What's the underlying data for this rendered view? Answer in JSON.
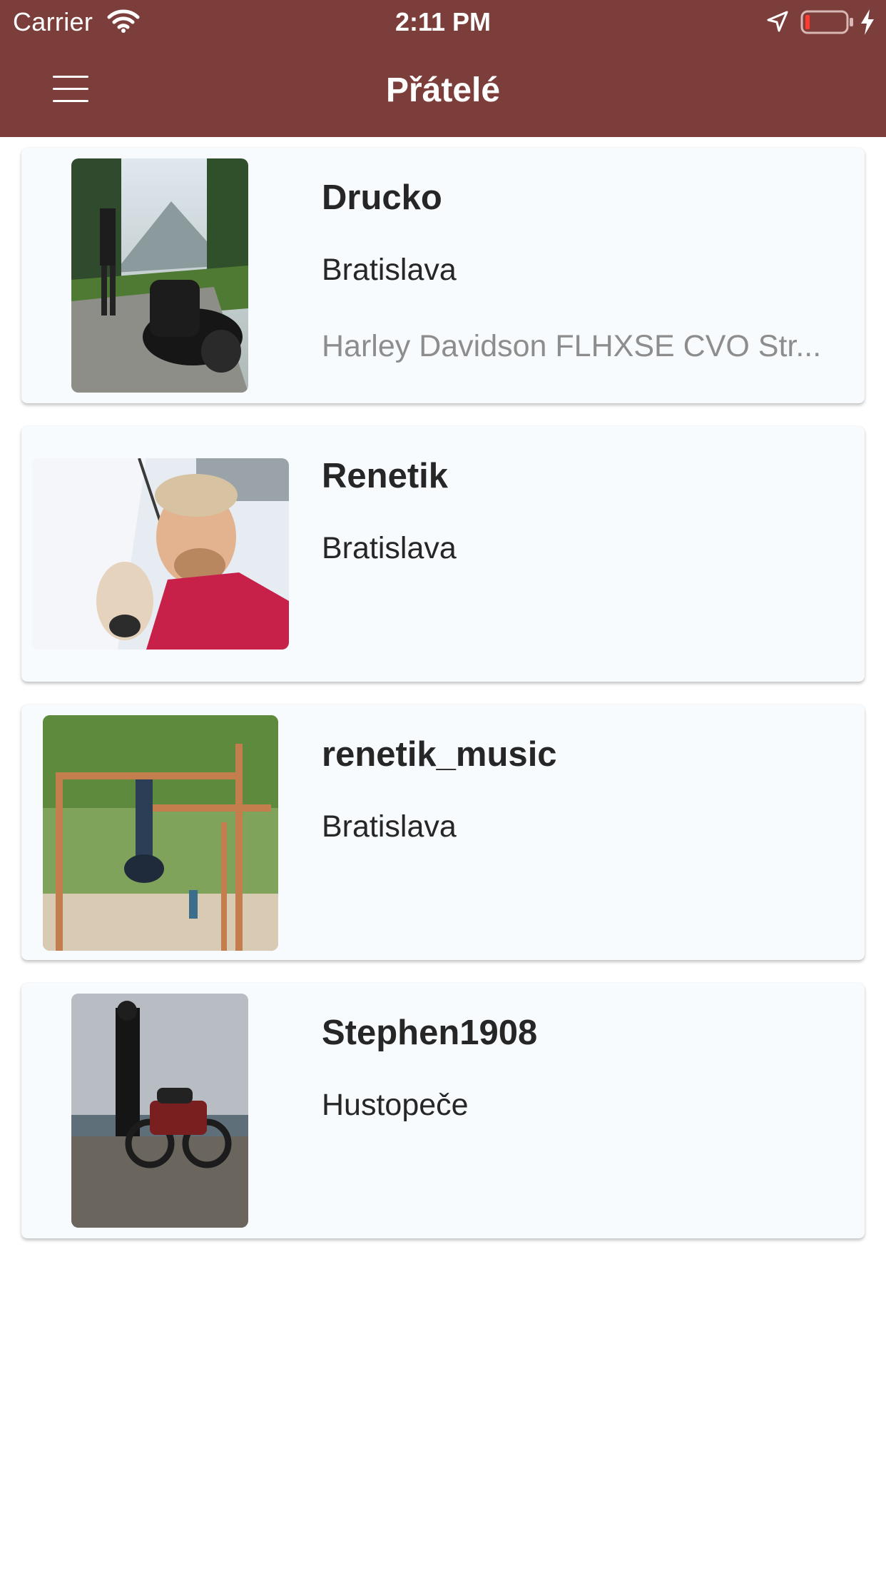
{
  "status_bar": {
    "carrier": "Carrier",
    "time": "2:11 PM"
  },
  "nav": {
    "title": "Přátelé",
    "menu_icon": "hamburger-menu-icon"
  },
  "friends": [
    {
      "name": "Drucko",
      "city": "Bratislava",
      "motorcycle": "Harley Davidson FLHXSE CVO Str..."
    },
    {
      "name": "Renetik",
      "city": "Bratislava"
    },
    {
      "name": "renetik_music",
      "city": "Bratislava"
    },
    {
      "name": "Stephen1908",
      "city": "Hustopeče"
    }
  ],
  "colors": {
    "header": "#7c3e3a",
    "card_background": "#f7fbfd",
    "primary_text": "#262626",
    "secondary_text": "#8d8d8d"
  }
}
